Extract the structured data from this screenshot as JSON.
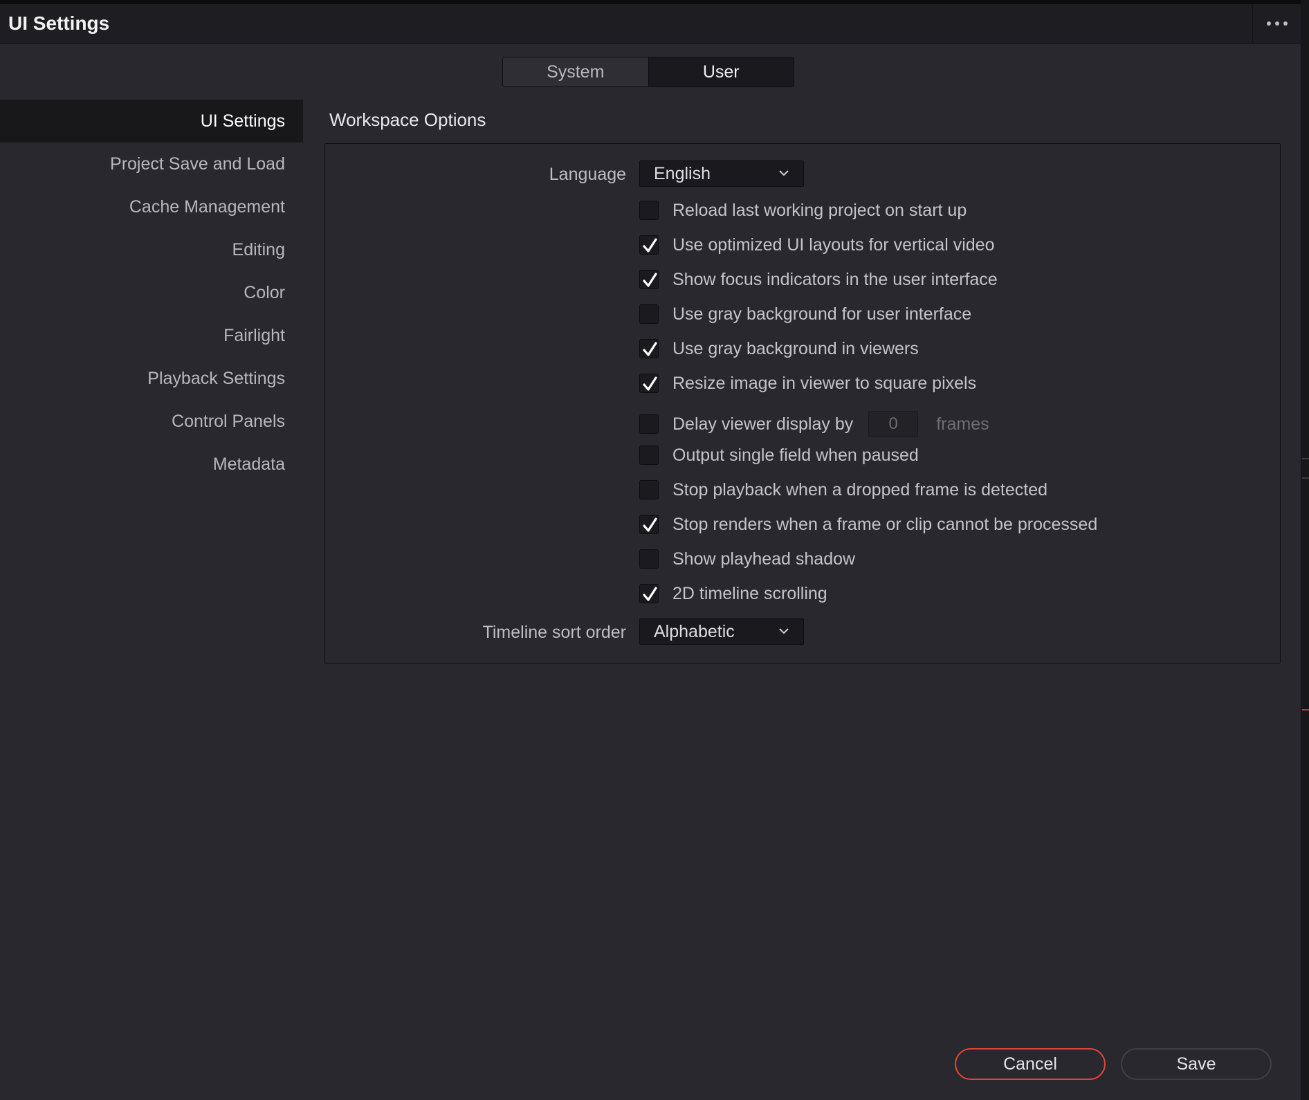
{
  "window": {
    "title": "UI Settings"
  },
  "tabs": [
    {
      "label": "System",
      "active": false
    },
    {
      "label": "User",
      "active": true
    }
  ],
  "sidebar": {
    "items": [
      {
        "label": "UI Settings",
        "active": true
      },
      {
        "label": "Project Save and Load"
      },
      {
        "label": "Cache Management"
      },
      {
        "label": "Editing"
      },
      {
        "label": "Color"
      },
      {
        "label": "Fairlight"
      },
      {
        "label": "Playback Settings"
      },
      {
        "label": "Control Panels"
      },
      {
        "label": "Metadata"
      }
    ]
  },
  "workspace": {
    "title": "Workspace Options",
    "language": {
      "label": "Language",
      "value": "English"
    },
    "options": [
      {
        "label": "Reload last working project on start up",
        "checked": false
      },
      {
        "label": "Use optimized UI layouts for vertical video",
        "checked": true
      },
      {
        "label": "Show focus indicators in the user interface",
        "checked": true
      },
      {
        "label": "Use gray background for user interface",
        "checked": false
      },
      {
        "label": "Use gray background in viewers",
        "checked": true
      },
      {
        "label": "Resize image in viewer to square pixels",
        "checked": true
      },
      {
        "label": "Delay viewer display by",
        "checked": false
      },
      {
        "label": "Output single field when paused",
        "checked": false
      },
      {
        "label": "Stop playback when a dropped frame is detected",
        "checked": false
      },
      {
        "label": "Stop renders when a frame or clip cannot be processed",
        "checked": true
      },
      {
        "label": "Show playhead shadow",
        "checked": false
      },
      {
        "label": "2D timeline scrolling",
        "checked": true
      }
    ],
    "delay": {
      "value": "0",
      "unit": "frames"
    },
    "sort_order": {
      "label": "Timeline sort order",
      "value": "Alphabetic"
    }
  },
  "buttons": {
    "cancel": "Cancel",
    "save": "Save"
  },
  "colors": {
    "background": "#28282e",
    "cancel_border": "#e0463b",
    "check": "#ffffff"
  }
}
